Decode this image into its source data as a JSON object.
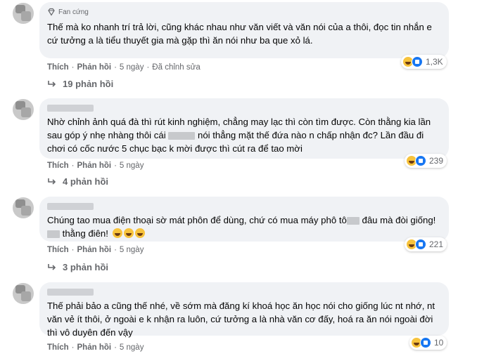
{
  "comments": [
    {
      "badge": "Fan cứng",
      "text": "Thế mà ko nhanh trí trả lời, cũng khác nhau như văn viết và văn nói của a thôi, đọc tin nhắn e cứ tưởng a là tiểu thuyết gia mà gặp thì ăn nói như ba que xỏ lá.",
      "reaction_count": "1,3K",
      "actions": {
        "like": "Thích",
        "reply": "Phản hồi",
        "time": "5 ngày",
        "edited": "Đã chỉnh sửa"
      },
      "replies": "19 phản hồi"
    },
    {
      "text_a": "Nhờ chỉnh ảnh quá đà thì rút kinh nghiệm, chẳng may lạc thì còn tìm được. Còn thằng kia lần sau góp ý nhẹ nhàng thôi cái",
      "text_b": "nói thẳng mặt thế đứa nào n chấp nhận đc? Lần đầu đi chơi có cốc nước 5 chục bạc k mời được thì cút ra để tao mời",
      "reaction_count": "239",
      "actions": {
        "like": "Thích",
        "reply": "Phản hồi",
        "time": "5 ngày"
      },
      "replies": "4 phản hồi"
    },
    {
      "text_a": "Chúng tao mua điện thoại sờ mát phôn để dùng, chứ có mua máy phô tô",
      "text_b": "đâu mà đòi giống!",
      "text_c": "thằng điên!",
      "reaction_count": "221",
      "actions": {
        "like": "Thích",
        "reply": "Phản hồi",
        "time": "5 ngày"
      },
      "replies": "3 phản hồi"
    },
    {
      "text": "Thế phải bảo a cũng thế nhé, về sớm mà đăng kí khoá học ăn học nói cho giống lúc nt nhớ, nt văn vẻ ít thôi, ở ngoài e k nhận ra luôn, cứ tưởng a là nhà văn cơ đấy, hoá ra ăn nói ngoài đời thì vô duyên đến vậy",
      "reaction_count": "10",
      "actions": {
        "like": "Thích",
        "reply": "Phản hồi",
        "time": "5 ngày"
      }
    }
  ]
}
